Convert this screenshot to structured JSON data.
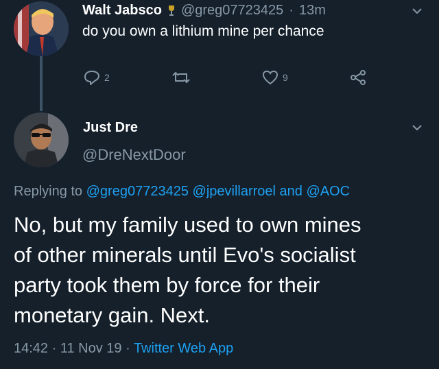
{
  "parent_tweet": {
    "display_name": "Walt Jabsco",
    "handle": "@greg07723425",
    "separator": "·",
    "time": "13m",
    "text": "do you own a lithium mine per chance",
    "replies_count": "2",
    "likes_count": "9",
    "icons": {
      "reply": "reply-icon",
      "retweet": "retweet-icon",
      "like": "heart-icon",
      "share": "share-icon",
      "badge": "trophy-badge-icon"
    }
  },
  "main_tweet": {
    "display_name": "Just Dre",
    "handle": "@DreNextDoor",
    "replying_prefix": "Replying to",
    "mentions": [
      "@greg07723425",
      "@jpevillarroel",
      "@AOC"
    ],
    "mention_joiner": "and",
    "text_lines": [
      "No, but my family used to own mines",
      "of other minerals until Evo's socialist",
      "party took them by force for their",
      "monetary gain. Next."
    ],
    "timestamp": "14:42 · 11 Nov 19 ·",
    "source": "Twitter Web App"
  },
  "colors": {
    "background": "#15202b",
    "muted": "#8899a6",
    "link": "#1da1f2",
    "thread_line": "#3d5466"
  }
}
